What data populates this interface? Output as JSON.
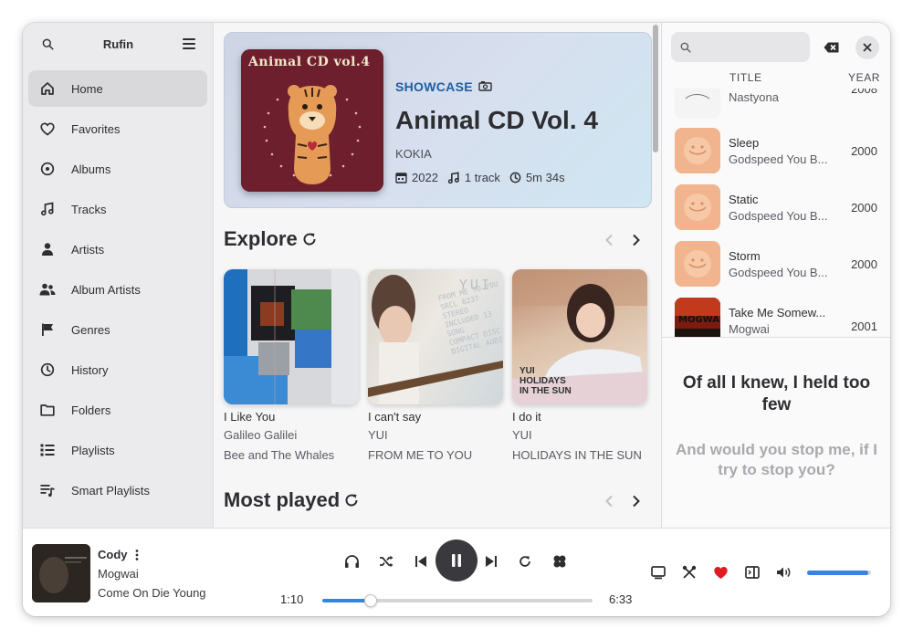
{
  "sidebar": {
    "title": "Rufin",
    "items": [
      {
        "label": "Home",
        "icon": "home-icon"
      },
      {
        "label": "Favorites",
        "icon": "heart-icon"
      },
      {
        "label": "Albums",
        "icon": "disc-icon"
      },
      {
        "label": "Tracks",
        "icon": "music-note-icon"
      },
      {
        "label": "Artists",
        "icon": "person-icon"
      },
      {
        "label": "Album Artists",
        "icon": "people-icon"
      },
      {
        "label": "Genres",
        "icon": "flag-icon"
      },
      {
        "label": "History",
        "icon": "clock-icon"
      },
      {
        "label": "Folders",
        "icon": "folder-icon"
      },
      {
        "label": "Playlists",
        "icon": "list-icon"
      },
      {
        "label": "Smart Playlists",
        "icon": "smart-list-icon"
      }
    ]
  },
  "showcase": {
    "label": "SHOWCASE",
    "cover_text": "Animal CD vol.4",
    "title": "Animal CD Vol. 4",
    "artist": "KOKIA",
    "year": "2022",
    "tracks": "1 track",
    "duration": "5m 34s"
  },
  "explore": {
    "heading": "Explore",
    "cards": [
      {
        "title": "I Like You",
        "artist": "Galileo Galilei",
        "album": "Bee and The Whales"
      },
      {
        "title": "I can't say",
        "artist": "YUI",
        "album": "FROM ME TO YOU"
      },
      {
        "title": "I do it",
        "artist": "YUI",
        "album": "HOLIDAYS IN THE SUN"
      }
    ],
    "cover_texts": {
      "yui1": "YUI",
      "yui1_lines": [
        "FROM ME TO YOU",
        "SRCL 6237 STEREO",
        "INCLUDED 13 SONG",
        "COMPACT DISC",
        "DIGITAL AUDIO"
      ],
      "yui2_lines": [
        "YUI",
        "HOLIDAYS",
        "IN THE SUN"
      ]
    }
  },
  "most_played": {
    "heading": "Most played"
  },
  "queue": {
    "search_placeholder": "",
    "col_title": "TITLE",
    "col_year": "YEAR",
    "mogwai_art_text": "MOGWAI",
    "tracks": [
      {
        "title": "",
        "artist": "Nastyona",
        "year": "2008"
      },
      {
        "title": "Sleep",
        "artist": "Godspeed You B...",
        "year": "2000"
      },
      {
        "title": "Static",
        "artist": "Godspeed You B...",
        "year": "2000"
      },
      {
        "title": "Storm",
        "artist": "Godspeed You B...",
        "year": "2000"
      },
      {
        "title": "Take Me Somew...",
        "artist": "Mogwai",
        "year": "2001"
      }
    ]
  },
  "lyrics": {
    "active": "Of all I knew, I held too few",
    "next": "And would you stop me, if I try to stop you?"
  },
  "player": {
    "title": "Cody",
    "artist": "Mogwai",
    "album": "Come On Die Young",
    "elapsed": "1:10",
    "total": "6:33",
    "progress_fraction": 0.18,
    "volume_fraction": 0.96,
    "accent": "#3584e4",
    "favorite_color": "#e01b24"
  }
}
